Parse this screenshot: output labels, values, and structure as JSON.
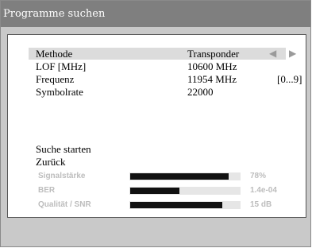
{
  "window": {
    "title": "Programme suchen"
  },
  "settings": [
    {
      "label": "Methode",
      "value": "Transponder",
      "range": "",
      "arrows": "◀ ▶"
    },
    {
      "label": "LOF [MHz]",
      "value": "10600 MHz",
      "range": "",
      "arrows": ""
    },
    {
      "label": "Frequenz",
      "value": "11954 MHz",
      "range": "[0...9]",
      "arrows": ""
    },
    {
      "label": "Symbolrate",
      "value": "22000",
      "range": "",
      "arrows": ""
    }
  ],
  "actions": {
    "start": "Suche starten",
    "back": "Zurück"
  },
  "signals": [
    {
      "label": "Signalstärke",
      "value": "78%",
      "level": 0.9
    },
    {
      "label": "BER",
      "value": "1.4e-04",
      "level": 0.45
    },
    {
      "label": "Qualität / SNR",
      "value": "15 dB",
      "level": 0.84
    }
  ],
  "colors": {
    "titlebar": "#7f7f7f",
    "background": "#c9c9c9",
    "panel": "#ffffff",
    "selected_row": "#dcdcdc",
    "bar_fill": "#111111",
    "signal_text": "#bdbdbd"
  },
  "icons": {
    "method_arrows": "left-right-arrow-icons"
  }
}
